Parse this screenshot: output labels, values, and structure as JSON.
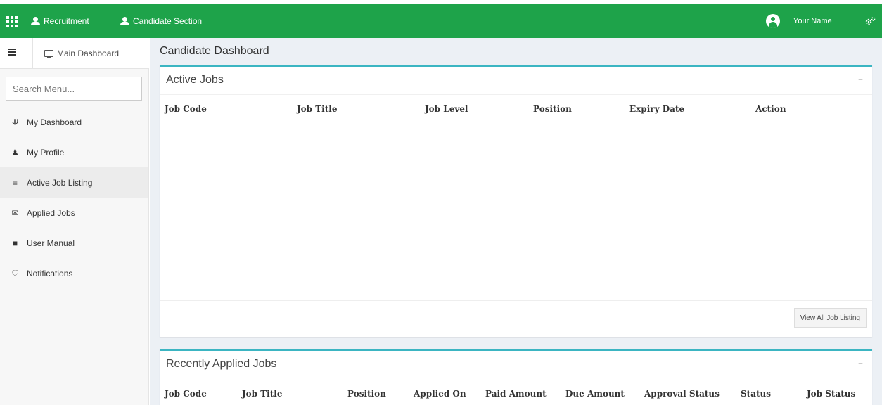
{
  "topbar": {
    "nav": [
      {
        "label": "Recruitment"
      },
      {
        "label": "Candidate Section"
      }
    ],
    "user_name": "Your Name",
    "brand_color": "#1ea34a"
  },
  "sidebar": {
    "main_dashboard": "Main Dashboard",
    "search_placeholder": "Search Menu...",
    "items": [
      {
        "label": "My Dashboard",
        "icon": "home-icon"
      },
      {
        "label": "My Profile",
        "icon": "user-icon"
      },
      {
        "label": "Active Job Listing",
        "icon": "list-icon",
        "active": true
      },
      {
        "label": "Applied Jobs",
        "icon": "envelope-icon"
      },
      {
        "label": "User Manual",
        "icon": "folder-icon"
      },
      {
        "label": "Notifications",
        "icon": "bell-icon"
      }
    ]
  },
  "main": {
    "page_title": "Candidate Dashboard",
    "active_jobs": {
      "title": "Active Jobs",
      "columns": [
        "Job Code",
        "Job Title",
        "Job Level",
        "Position",
        "Expiry Date",
        "Action"
      ],
      "view_all_label": "View All Job Listing"
    },
    "recent_jobs": {
      "title": "Recently Applied Jobs",
      "columns": [
        "Job Code",
        "Job Title",
        "Position",
        "Applied On",
        "Paid Amount",
        "Due Amount",
        "Approval Status",
        "Status",
        "Job Status"
      ]
    },
    "accent_color": "#3bb5c2"
  }
}
